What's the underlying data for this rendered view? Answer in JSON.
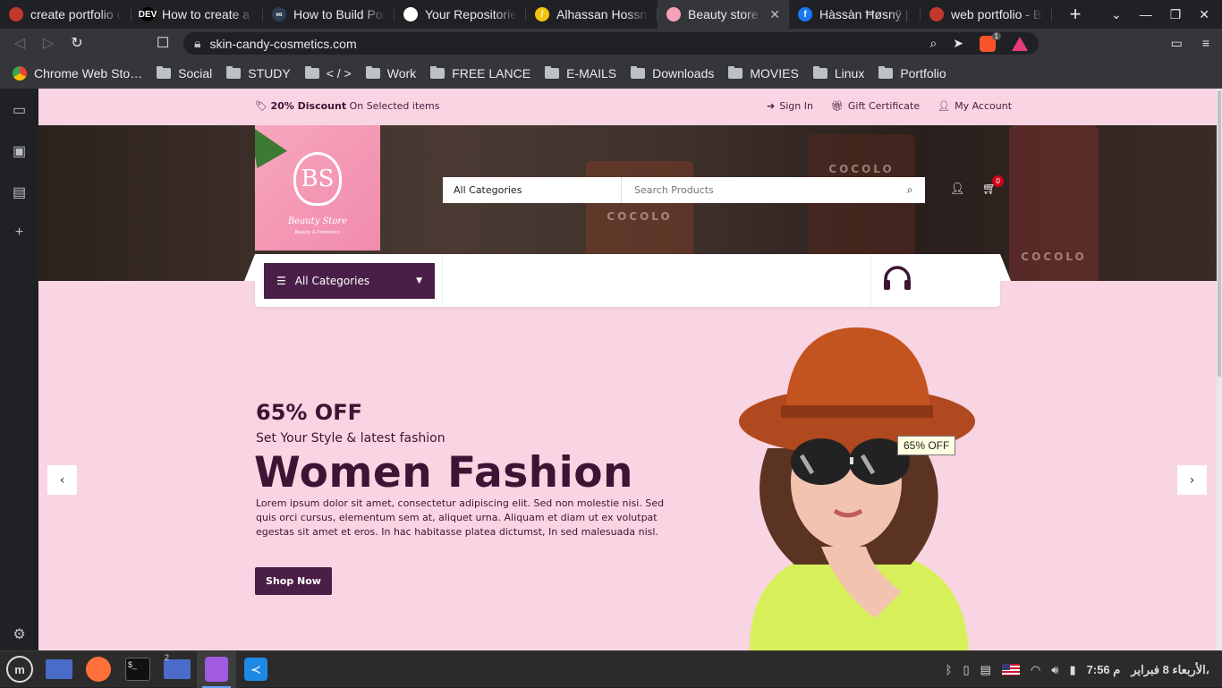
{
  "browser": {
    "tabs": [
      {
        "title": "create portfolio o",
        "fav_color": "#c0392b",
        "fav_text": ""
      },
      {
        "title": "How to create a si",
        "fav_color": "#000000",
        "fav_text": "DEV"
      },
      {
        "title": "How to Build Port",
        "fav_color": "#2c3e50",
        "fav_text": "∞"
      },
      {
        "title": "Your Repositories",
        "fav_color": "#ffffff",
        "fav_text": ""
      },
      {
        "title": "Alhassan Hossny",
        "fav_color": "#f1c40f",
        "fav_text": "/"
      },
      {
        "title": "Beauty store S",
        "fav_color": "#f5a0b8",
        "fav_text": ""
      },
      {
        "title": "Hàssàn Ħøsnÿ | Fa",
        "fav_color": "#1877f2",
        "fav_text": "f"
      },
      {
        "title": "web portfolio - Br",
        "fav_color": "#c0392b",
        "fav_text": ""
      }
    ],
    "active_tab": 5,
    "url": "skin-candy-cosmetics.com",
    "brave_badge": "1",
    "bookmarks": [
      {
        "label": "Chrome Web Sto…",
        "type": "app"
      },
      {
        "label": "Social",
        "type": "folder"
      },
      {
        "label": "STUDY",
        "type": "folder"
      },
      {
        "label": "< / >",
        "type": "folder"
      },
      {
        "label": "Work",
        "type": "folder"
      },
      {
        "label": "FREE LANCE",
        "type": "folder"
      },
      {
        "label": "E-MAILS",
        "type": "folder"
      },
      {
        "label": "Downloads",
        "type": "folder"
      },
      {
        "label": "MOVIES",
        "type": "folder"
      },
      {
        "label": "Linux",
        "type": "folder"
      },
      {
        "label": "Portfolio",
        "type": "folder"
      }
    ]
  },
  "site": {
    "topbar": {
      "discount_bold": "20% Discount",
      "discount_rest": "On Selected items",
      "links": [
        "Sign In",
        "Gift Certificate",
        "My Account"
      ]
    },
    "logo": {
      "monogram": "BS",
      "name": "Beauty Store",
      "tagline": "Beauty & Cosmetics"
    },
    "search": {
      "category": "All Categories",
      "placeholder": "Search Products"
    },
    "cart_count": "0",
    "bottle_label": "COCOLO",
    "menu": {
      "categories_label": "All Categories"
    },
    "hero": {
      "offer": "65% OFF",
      "subtitle": "Set Your Style & latest fashion",
      "title": "Women Fashion",
      "description": "Lorem ipsum dolor sit amet, consectetur adipiscing elit. Sed non molestie nisi. Sed quis orci cursus, elementum sem at, aliquet urna. Aliquam et diam ut ex volutpat egestas sit amet et eros. In hac habitasse platea dictumst, In sed malesuada nisl.",
      "button": "Shop Now",
      "tooltip": "65% OFF"
    },
    "colors": {
      "accent": "#4a1f47",
      "page_bg": "#f9d4e2",
      "title": "#3b1533"
    }
  },
  "taskbar": {
    "time": "7:56 م",
    "date": "الأربعاء 8 فبراير،",
    "files_badge": "2"
  }
}
